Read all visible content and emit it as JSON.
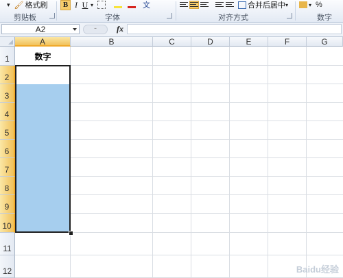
{
  "ribbon": {
    "format_painter_label": "格式刷",
    "bold": "B",
    "italic": "I",
    "underline": "U",
    "wen": "文",
    "merge_center_label": "合并后居中",
    "percent": "%",
    "groups": {
      "clipboard": "剪贴板",
      "font": "字体",
      "alignment": "对齐方式",
      "number": "数字"
    }
  },
  "formula_bar": {
    "name_box": "A2",
    "fx": "fx",
    "formula": ""
  },
  "columns": [
    "A",
    "B",
    "C",
    "D",
    "E",
    "F",
    "G"
  ],
  "rows": [
    "1",
    "2",
    "3",
    "4",
    "5",
    "6",
    "7",
    "8",
    "9",
    "10",
    "11",
    "12"
  ],
  "cells": {
    "A1": "数字"
  },
  "selection": {
    "range": "A2:A10",
    "active_cell": "A2",
    "highlight_color": "#a6ceee"
  },
  "watermark": "Baidu经验"
}
